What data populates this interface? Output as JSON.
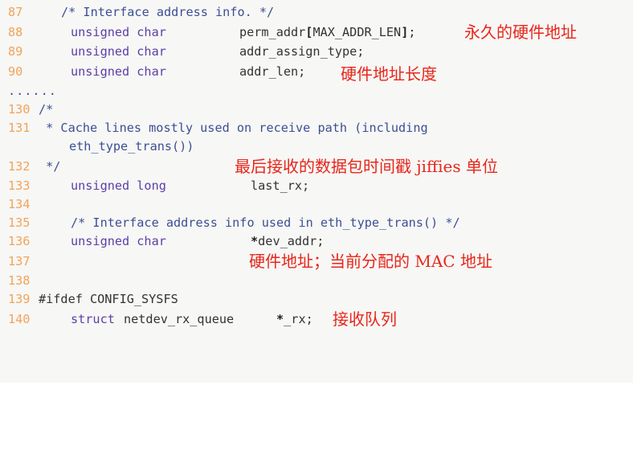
{
  "lines": [
    {
      "num": "87",
      "comment": "/* Interface address info. */"
    },
    {
      "num": "88",
      "type": "unsigned char",
      "name_pre": "perm_addr",
      "name_bold": "[",
      "name_mid": "MAX_ADDR_LEN",
      "name_bold2": "]",
      "name_post": ";",
      "annotation": "永久的硬件地址"
    },
    {
      "num": "89",
      "type": "unsigned char",
      "name": "addr_assign_type;"
    },
    {
      "num": "90",
      "type": "unsigned char",
      "name": "addr_len;",
      "annotation": "硬件地址长度"
    },
    {
      "ellipsis": "......"
    },
    {
      "num": "130",
      "comment": "/*"
    },
    {
      "num": "131",
      "comment": " * Cache lines mostly used on receive path (including"
    },
    {
      "comment_cont": "eth_type_trans())"
    },
    {
      "num": "132",
      "comment": " */",
      "annotation": "最后接收的数据包时间戳 jiffies 单位"
    },
    {
      "num": "133",
      "type": "unsigned long",
      "name": "last_rx;"
    },
    {
      "num": "134"
    },
    {
      "num": "135",
      "comment": "/* Interface address info used in eth_type_trans() */"
    },
    {
      "num": "136",
      "type": "unsigned char",
      "name_bold": "*",
      "name_post": "dev_addr;"
    },
    {
      "num": "137",
      "annotation": "硬件地址；当前分配的 MAC 地址"
    },
    {
      "num": "138"
    },
    {
      "num": "139",
      "preproc": "#ifdef CONFIG_SYSFS"
    },
    {
      "num": "140",
      "type": "struct",
      "type_rest": "netdev_rx_queue",
      "name_bold": "*",
      "name_post": "_rx;",
      "annotation": "接收队列"
    }
  ]
}
